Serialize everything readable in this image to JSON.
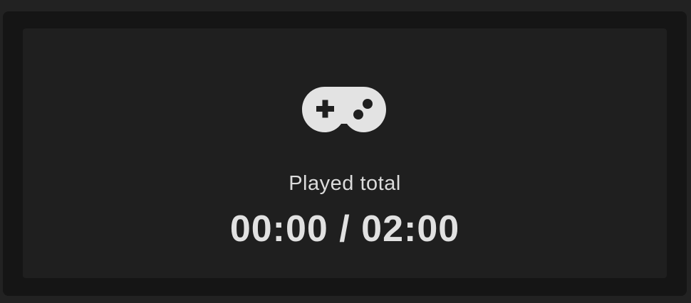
{
  "played_panel": {
    "icon": "gamepad-icon",
    "label": "Played total",
    "time": "00:00 / 02:00"
  },
  "colors": {
    "page_background": "#222222",
    "frame_background": "#151515",
    "card_background": "#1f1f1f",
    "icon": "#e3e3e3",
    "text": "#dcdcdc"
  }
}
